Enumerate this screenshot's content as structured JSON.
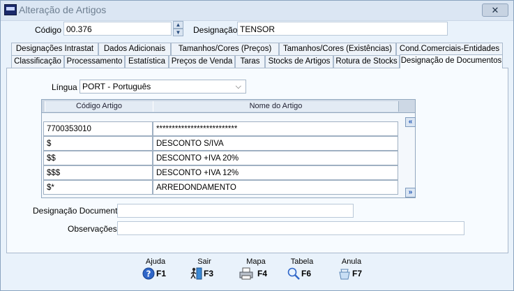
{
  "window": {
    "title": "Alteração de Artigos",
    "close": "✕"
  },
  "header": {
    "codigo_label": "Código",
    "codigo_value": "00.376",
    "designacao_label": "Designação",
    "designacao_value": "TENSOR"
  },
  "tabs_row1": [
    "Designações Intrastat",
    "Dados Adicionais",
    "Tamanhos/Cores (Preços)",
    "Tamanhos/Cores (Existências)",
    "Cond.Comerciais-Entidades"
  ],
  "tabs_row2": [
    "Classificação",
    "Processamento",
    "Estatística",
    "Preços de Venda",
    "Taras",
    "Stocks de Artigos",
    "Rotura de Stocks",
    "Designação de Documentos"
  ],
  "lingua": {
    "label": "Língua",
    "value": "PORT - Português"
  },
  "grid": {
    "columns": [
      "Código Artigo",
      "Nome do Artigo"
    ],
    "rows": [
      [
        "7700353010",
        "**************************"
      ],
      [
        "$",
        "DESCONTO S/IVA"
      ],
      [
        "$$",
        "DESCONTO +IVA 20%"
      ],
      [
        "$$$",
        "DESCONTO +IVA 12%"
      ],
      [
        "$*",
        "ARREDONDAMENTO"
      ]
    ],
    "nav_up": "«",
    "nav_down": "»"
  },
  "fields": {
    "designacao_documento_label": "Designação Documento",
    "designacao_documento_value": "",
    "observacoes_label": "Observações",
    "observacoes_value": ""
  },
  "footer": [
    {
      "top": "Ajuda",
      "key": "F1",
      "icon": "help-icon"
    },
    {
      "top": "Sair",
      "key": "F3",
      "icon": "exit-icon"
    },
    {
      "top": "Mapa",
      "key": "F4",
      "icon": "printer-icon"
    },
    {
      "top": "Tabela",
      "key": "F6",
      "icon": "table-search-icon"
    },
    {
      "top": "Anula",
      "key": "F7",
      "icon": "cancel-icon"
    }
  ]
}
